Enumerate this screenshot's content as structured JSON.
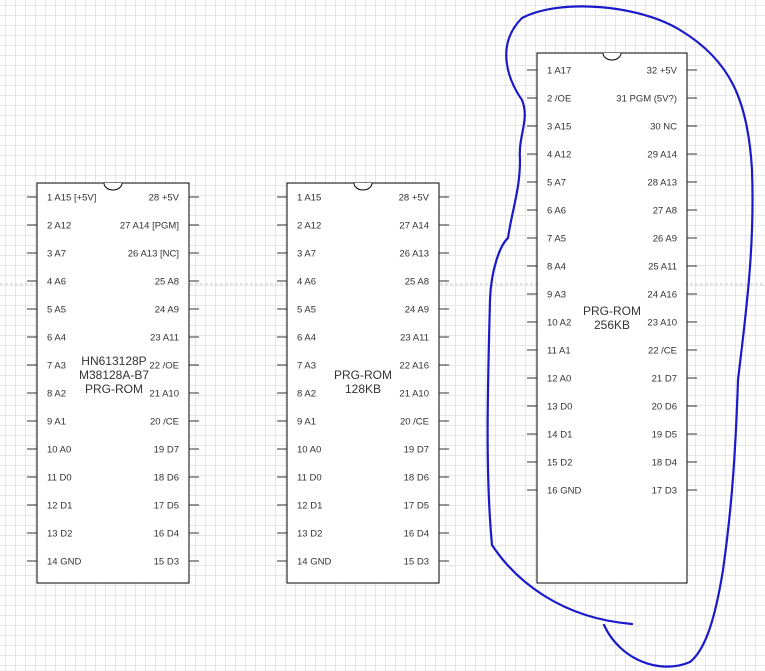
{
  "colors": {
    "background": "#ffffff",
    "grid": "#e6e6e6",
    "chip_stroke": "#000000",
    "pin": "#333333",
    "text": "#333333",
    "annotation": "#1a1acc"
  },
  "chips": [
    {
      "id": "chip-hn613128p",
      "label_lines": [
        "HN613128P",
        "M38128A-B7",
        "PRG-ROM"
      ],
      "left_pins": [
        "1 A15 [+5V]",
        "2 A12",
        "3 A7",
        "4 A6",
        "5 A5",
        "6 A4",
        "7 A3",
        "8 A2",
        "9 A1",
        "10 A0",
        "11 D0",
        "12 D1",
        "13 D2",
        "14 GND"
      ],
      "right_pins": [
        "28 +5V",
        "27 A14 [PGM]",
        "26 A13 [NC]",
        "25 A8",
        "24 A9",
        "23 A11",
        "22 /OE",
        "21 A10",
        "20 /CE",
        "19 D7",
        "18 D6",
        "17 D5",
        "16 D4",
        "15 D3"
      ]
    },
    {
      "id": "chip-prg-rom-128kb",
      "label_lines": [
        "PRG-ROM",
        "128KB"
      ],
      "left_pins": [
        "1 A15",
        "2 A12",
        "3 A7",
        "4 A6",
        "5 A5",
        "6 A4",
        "7 A3",
        "8 A2",
        "9 A1",
        "10 A0",
        "11 D0",
        "12 D1",
        "13 D2",
        "14 GND"
      ],
      "right_pins": [
        "28 +5V",
        "27 A14",
        "26 A13",
        "25 A8",
        "24 A9",
        "23 A11",
        "22 A16",
        "21 A10",
        "20 /CE",
        "19 D7",
        "18 D6",
        "17 D5",
        "16 D4",
        "15 D3"
      ]
    },
    {
      "id": "chip-prg-rom-256kb",
      "label_lines": [
        "PRG-ROM",
        "256KB"
      ],
      "left_pins": [
        "1 A17",
        "2 /OE",
        "3 A15",
        "4 A12",
        "5 A7",
        "6 A6",
        "7 A5",
        "8 A4",
        "9 A3",
        "10 A2",
        "11 A1",
        "12 A0",
        "13 D0",
        "14 D1",
        "15 D2",
        "16 GND"
      ],
      "right_pins": [
        "32 +5V",
        "31 PGM (5V?)",
        "30 NC",
        "29 A14",
        "28 A13",
        "27 A8",
        "26 A9",
        "25 A11",
        "24 A16",
        "23 A10",
        "22 /CE",
        "21 D7",
        "20 D6",
        "19 D5",
        "18 D4",
        "17 D3"
      ]
    }
  ]
}
